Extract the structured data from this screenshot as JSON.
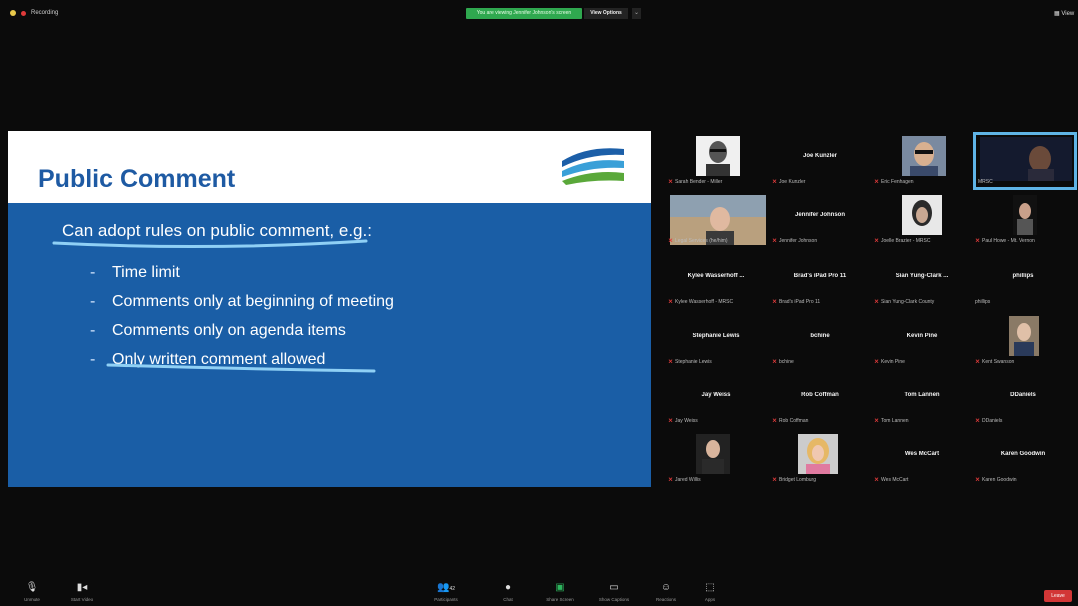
{
  "top": {
    "recording_label": "Recording",
    "share_banner": "You are viewing Jennifer Johnson's screen",
    "view_options": "View Options",
    "view_caret": "⌄",
    "view_label": "View"
  },
  "slide": {
    "title": "Public Comment",
    "main_text": "Can adopt rules on public comment, e.g.:",
    "bullets": [
      "Time limit",
      "Comments only at beginning of meeting",
      "Comments only on agenda items",
      "Only written comment allowed"
    ]
  },
  "participants": [
    {
      "display": "",
      "label": "Sarah Bender - Miller"
    },
    {
      "display": "Joe Kunzler",
      "label": "Joe Kunzler"
    },
    {
      "display": "",
      "label": "Eric Fenhagen"
    },
    {
      "display": "",
      "label": "MRSC"
    },
    {
      "display": "",
      "label": "Legal Services (he/him)"
    },
    {
      "display": "Jennifer Johnson",
      "label": "Jennifer Johnson"
    },
    {
      "display": "",
      "label": "Joelle Brazier - MRSC"
    },
    {
      "display": "",
      "label": "Paul Howe - Mt. Vernon"
    },
    {
      "display": "Kylee Wasserhoff ...",
      "label": "Kylee Wasserhoff - MRSC"
    },
    {
      "display": "Brad's iPad Pro 11",
      "label": "Brad's iPad Pro 11"
    },
    {
      "display": "Sian Yung-Clark ...",
      "label": "Sian Yung-Clark County"
    },
    {
      "display": "phillips",
      "label": "phillips"
    },
    {
      "display": "Stephanie Lewis",
      "label": "Stephanie Lewis"
    },
    {
      "display": "bchine",
      "label": "bchine"
    },
    {
      "display": "Kevin Pine",
      "label": "Kevin Pine"
    },
    {
      "display": "",
      "label": "Kent Swanson"
    },
    {
      "display": "Jay Weiss",
      "label": "Jay Weiss"
    },
    {
      "display": "Rob Coffman",
      "label": "Rob Coffman"
    },
    {
      "display": "Tom Lannen",
      "label": "Tom Lannen"
    },
    {
      "display": "DDaniels",
      "label": "DDaniels"
    },
    {
      "display": "",
      "label": "Jared Willis"
    },
    {
      "display": "",
      "label": "Bridget Lomburg"
    },
    {
      "display": "Wes McCart",
      "label": "Wes McCart"
    },
    {
      "display": "Karen Goodwin",
      "label": "Karen Goodwin"
    }
  ],
  "toolbar": {
    "unmute": "Unmute",
    "start_video": "Start Video",
    "participants": "Participants",
    "participants_count": "42",
    "chat": "Chat",
    "share_screen": "Share Screen",
    "show_captions": "Show Captions",
    "reactions": "Reactions",
    "apps": "Apps",
    "leave": "Leave"
  },
  "colors": {
    "slide_blue": "#1a5ea6",
    "title_blue": "#1e5aa3",
    "annotation": "#8fd0f5",
    "active_speaker": "#5fb4e6",
    "share_green": "#2fa84f",
    "leave_red": "#d23636"
  }
}
